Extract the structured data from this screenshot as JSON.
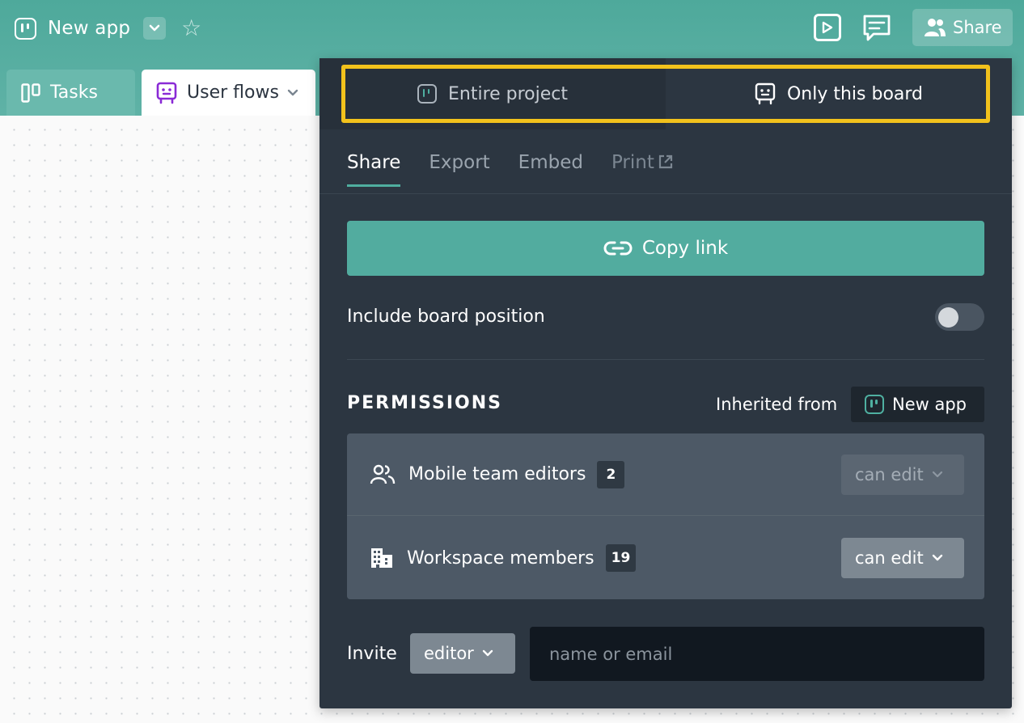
{
  "header": {
    "app_title": "New app",
    "share_label": "Share"
  },
  "tabs": [
    {
      "label": "Tasks",
      "icon": "board-icon"
    },
    {
      "label": "User flows",
      "icon": "flow-icon",
      "active": true
    }
  ],
  "share_panel": {
    "scope": {
      "entire_project": "Entire project",
      "only_this_board": "Only this board",
      "selected": "Only this board"
    },
    "subtabs": [
      "Share",
      "Export",
      "Embed",
      "Print"
    ],
    "active_subtab": "Share",
    "copy_link": "Copy link",
    "include_board_position": "Include board position",
    "include_board_position_on": false,
    "permissions": {
      "title": "PERMISSIONS",
      "inherited_from_label": "Inherited from",
      "inherited_from_app": "New app",
      "rows": [
        {
          "name": "Mobile team editors",
          "count": "2",
          "role": "can edit",
          "icon": "group-icon",
          "disabled": true
        },
        {
          "name": "Workspace members",
          "count": "19",
          "role": "can edit",
          "icon": "building-icon",
          "disabled": false
        }
      ]
    },
    "invite": {
      "label": "Invite",
      "role": "editor",
      "placeholder": "name or email"
    }
  },
  "colors": {
    "header": "#54ab9e",
    "panel": "#2c3641",
    "accent": "#52ac9f",
    "highlight": "#f2c21c",
    "flow_icon": "#8a2ad6"
  }
}
